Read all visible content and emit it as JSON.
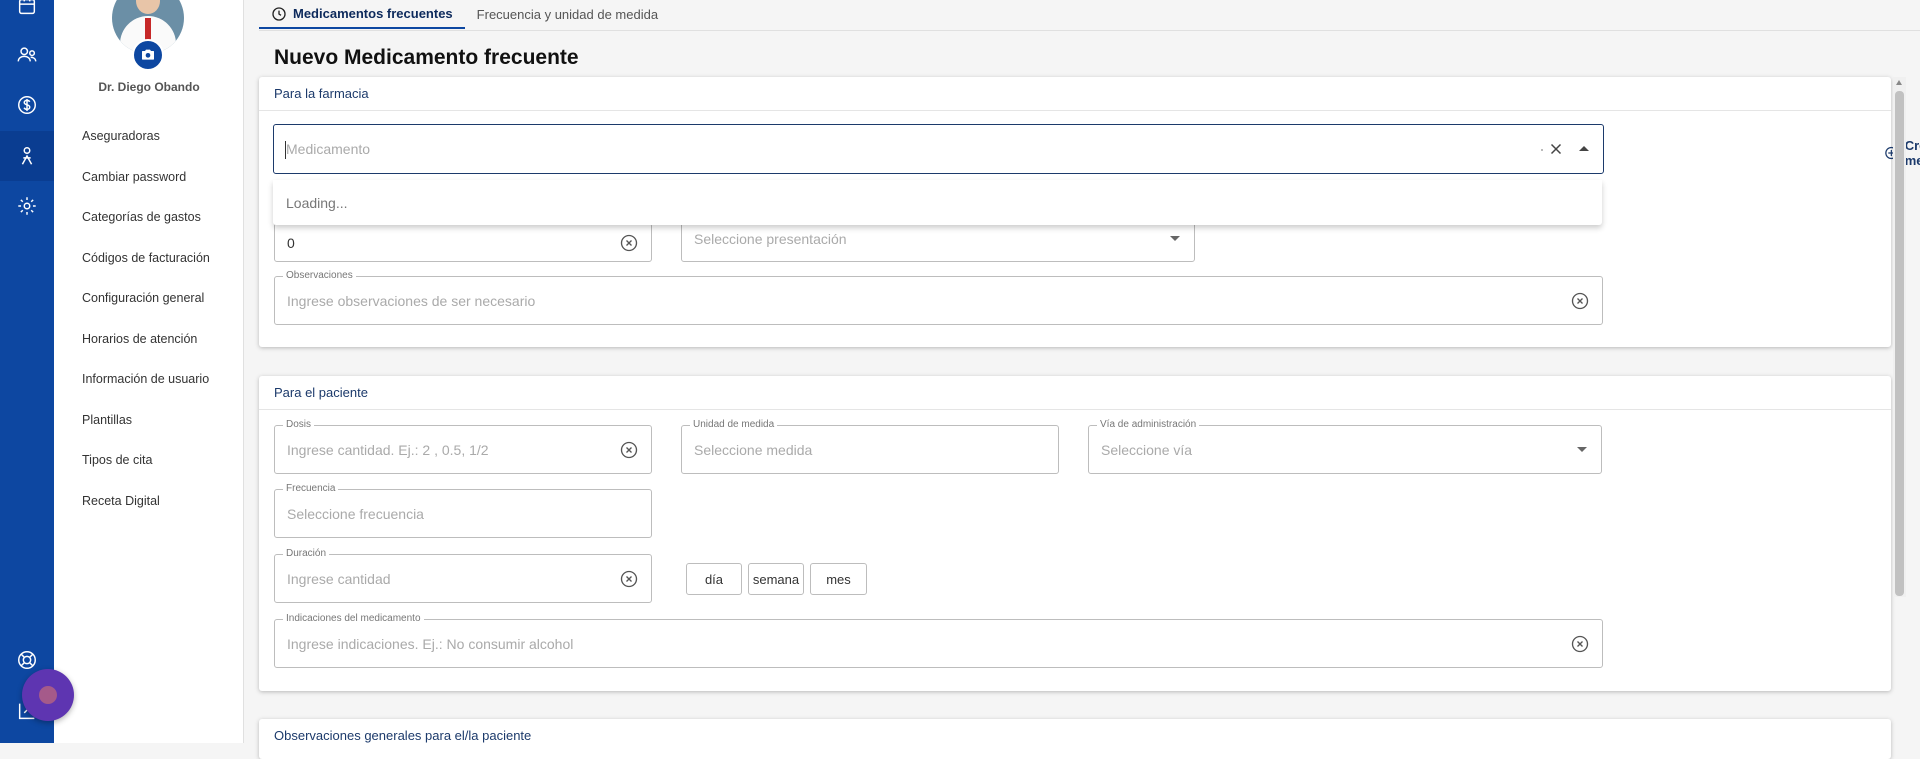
{
  "rail": {
    "icons": [
      "calendar-icon",
      "users-icon",
      "dollar-icon",
      "medication-icon",
      "gear-icon",
      "help-icon",
      "logout-icon"
    ]
  },
  "user": {
    "name": "Dr. Diego Obando"
  },
  "sidebar": {
    "items": [
      {
        "label": "Aseguradoras"
      },
      {
        "label": "Cambiar password"
      },
      {
        "label": "Categorías de gastos"
      },
      {
        "label": "Códigos de facturación"
      },
      {
        "label": "Configuración general"
      },
      {
        "label": "Horarios de atención"
      },
      {
        "label": "Información de usuario"
      },
      {
        "label": "Plantillas"
      },
      {
        "label": "Tipos de cita"
      },
      {
        "label": "Receta Digital"
      }
    ]
  },
  "tabs": [
    {
      "label": "Medicamentos frecuentes",
      "active": true
    },
    {
      "label": "Frecuencia y unidad de medida",
      "active": false
    }
  ],
  "page": {
    "title": "Nuevo Medicamento frecuente"
  },
  "pharmacy": {
    "heading": "Para la farmacia",
    "medicamento_placeholder": "Medicamento",
    "dropdown_loading": "Loading...",
    "create_label": "Crear medicamento",
    "cantidad_value": "0",
    "presentacion_placeholder": "Seleccione presentación",
    "observaciones_label": "Observaciones",
    "observaciones_placeholder": "Ingrese observaciones de ser necesario"
  },
  "patient": {
    "heading": "Para el paciente",
    "dosis_label": "Dosis",
    "dosis_placeholder": "Ingrese cantidad. Ej.: 2 , 0.5, 1/2",
    "unidad_label": "Unidad de medida",
    "unidad_placeholder": "Seleccione medida",
    "via_label": "Vía de administración",
    "via_placeholder": "Seleccione vía",
    "frecuencia_label": "Frecuencia",
    "frecuencia_placeholder": "Seleccione frecuencia",
    "duracion_label": "Duración",
    "duracion_placeholder": "Ingrese cantidad",
    "duration_units": [
      "día",
      "semana",
      "mes"
    ],
    "indicaciones_label": "Indicaciones del medicamento",
    "indicaciones_placeholder": "Ingrese indicaciones. Ej.: No consumir alcohol"
  },
  "general": {
    "heading": "Observaciones generales para el/la paciente"
  },
  "colors": {
    "primary": "#0d47a1",
    "accent": "#1c3a6b",
    "fab": "#5e35b1"
  }
}
